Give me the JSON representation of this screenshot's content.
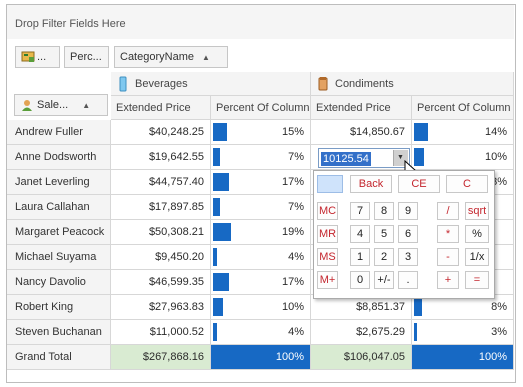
{
  "filter_area": {
    "text": "Drop Filter Fields Here"
  },
  "field_buttons": {
    "data": "...",
    "percent": "Perc...",
    "category": "CategoryName",
    "sales": "Sale..."
  },
  "columns": {
    "beverages": "Beverages",
    "condiments": "Condiments",
    "extended_price": "Extended Price",
    "percent_of_column": "Percent Of Column"
  },
  "rows": [
    {
      "name": "Andrew Fuller",
      "bev_price": "$40,248.25",
      "bev_pct": "15%",
      "bev_pct_value": 15,
      "con_price": "$14,850.67",
      "con_pct": "14%",
      "con_pct_value": 14
    },
    {
      "name": "Anne Dodsworth",
      "bev_price": "$19,642.55",
      "bev_pct": "7%",
      "bev_pct_value": 7,
      "con_price": "10125.54",
      "con_pct": "10%",
      "con_pct_value": 10
    },
    {
      "name": "Janet Leverling",
      "bev_price": "$44,757.40",
      "bev_pct": "17%",
      "bev_pct_value": 17,
      "con_price": "",
      "con_pct": "3%",
      "con_pct_value": 3
    },
    {
      "name": "Laura Callahan",
      "bev_price": "$17,897.85",
      "bev_pct": "7%",
      "bev_pct_value": 7,
      "con_price": "",
      "con_pct": "",
      "con_pct_value": 0
    },
    {
      "name": "Margaret Peacock",
      "bev_price": "$50,308.21",
      "bev_pct": "19%",
      "bev_pct_value": 19,
      "con_price": "",
      "con_pct": "",
      "con_pct_value": 0
    },
    {
      "name": "Michael Suyama",
      "bev_price": "$9,450.20",
      "bev_pct": "4%",
      "bev_pct_value": 4,
      "con_price": "",
      "con_pct": "",
      "con_pct_value": 0
    },
    {
      "name": "Nancy Davolio",
      "bev_price": "$46,599.35",
      "bev_pct": "17%",
      "bev_pct_value": 17,
      "con_price": "",
      "con_pct": "",
      "con_pct_value": 0
    },
    {
      "name": "Robert King",
      "bev_price": "$27,963.83",
      "bev_pct": "10%",
      "bev_pct_value": 10,
      "con_price": "$8,851.37",
      "con_pct": "8%",
      "con_pct_value": 8
    },
    {
      "name": "Steven Buchanan",
      "bev_price": "$11,000.52",
      "bev_pct": "4%",
      "bev_pct_value": 4,
      "con_price": "$2,675.29",
      "con_pct": "3%",
      "con_pct_value": 3
    }
  ],
  "grand_total": {
    "label": "Grand Total",
    "bev_price": "$267,868.16",
    "bev_pct": "100%",
    "con_price": "$106,047.05",
    "con_pct": "100%"
  },
  "editor": {
    "value": "10125.54"
  },
  "calculator": {
    "keys": [
      [
        "",
        "Back",
        "CE",
        "C"
      ],
      [
        "MC",
        "7",
        "8",
        "9",
        "/",
        "sqrt"
      ],
      [
        "MR",
        "4",
        "5",
        "6",
        "*",
        "%"
      ],
      [
        "MS",
        "1",
        "2",
        "3",
        "-",
        "1/x"
      ],
      [
        "M+",
        "0",
        "+/-",
        ".",
        "+",
        "="
      ]
    ]
  },
  "colors": {
    "bar": "#1769c4",
    "grand_total_bg": "#d9ebd2",
    "key_red": "#c4262e"
  }
}
